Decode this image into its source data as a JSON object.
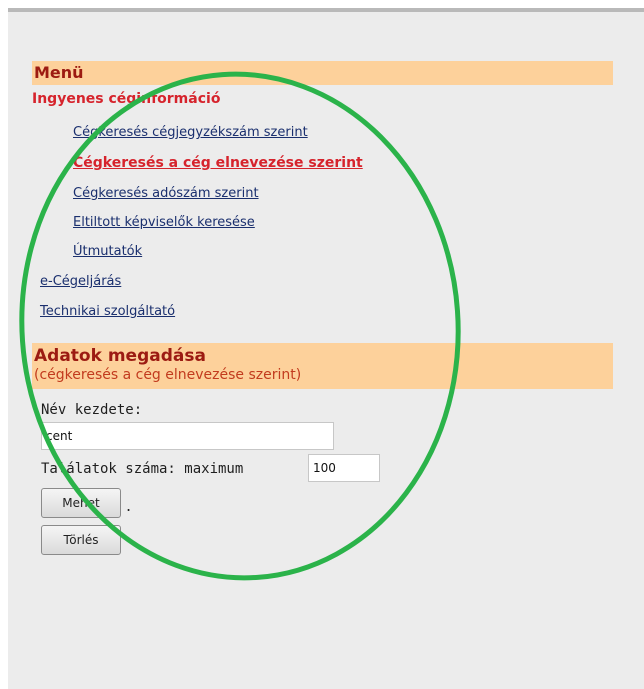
{
  "menu": {
    "title": "Menü",
    "section_title": "Ingyenes céginformáció",
    "sub_links": [
      "Cégkeresés cégjegyzékszám szerint",
      "Cégkeresés a cég elnevezése szerint",
      "Cégkeresés adószám szerint",
      "Eltiltott képviselők keresése",
      "Útmutatók"
    ],
    "links": [
      "e-Cégeljárás",
      "Technikai szolgáltató"
    ]
  },
  "form": {
    "title": "Adatok megadása",
    "subtitle": "(cégkeresés a cég elnevezése szerint)",
    "name_label": "Név kezdete:",
    "name_value": "cent",
    "results_label": "Találatok száma: maximum",
    "results_value": "100",
    "go_button": "Mehet",
    "dot": ".",
    "clear_button": "Törlés"
  },
  "colors": {
    "header_bg": "#fdd19b",
    "accent_red": "#d6232c",
    "title_red": "#9c1b12",
    "link_blue": "#1a2f6e",
    "annotation_green": "#2bb34a"
  }
}
